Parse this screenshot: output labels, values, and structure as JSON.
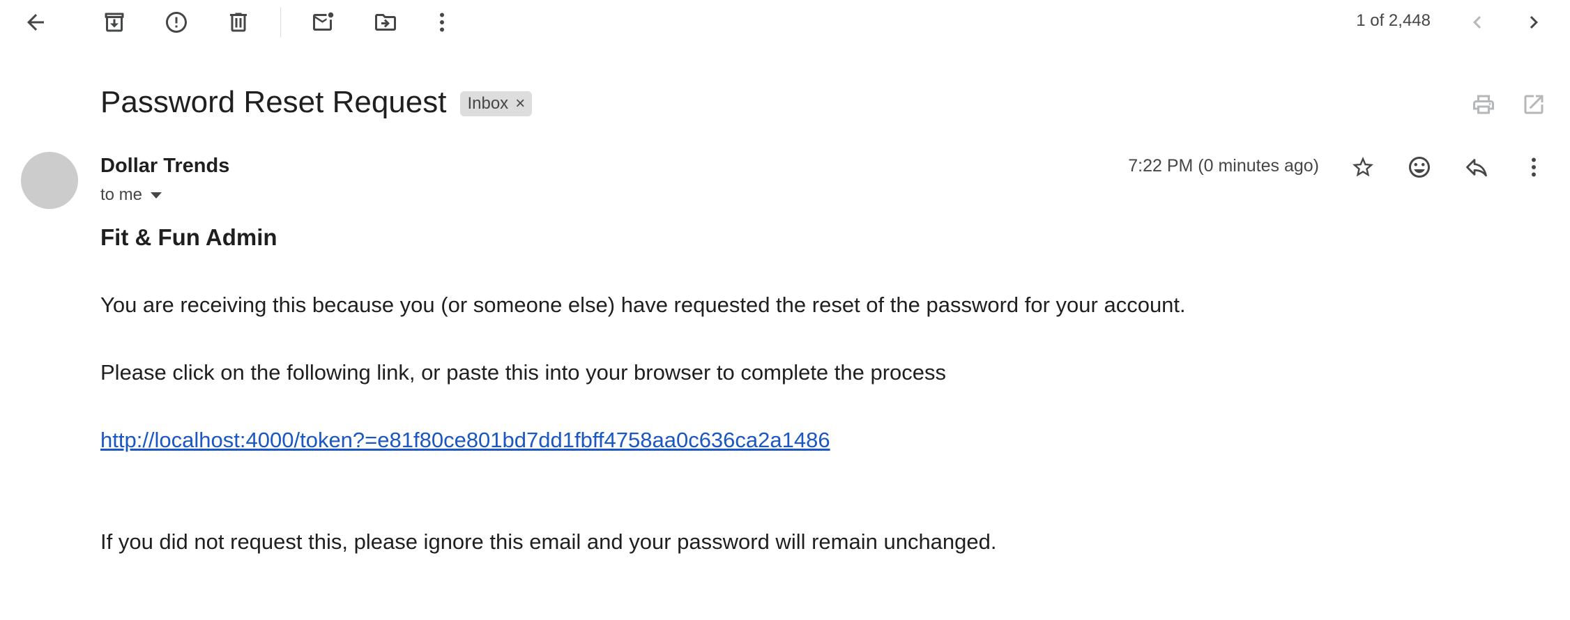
{
  "toolbar": {
    "icons": [
      "back-icon",
      "archive-icon",
      "report-spam-icon",
      "delete-icon",
      "mark-unread-icon",
      "move-to-icon",
      "more-vert-icon"
    ],
    "counter": "1 of 2,448",
    "nav_icons": [
      "chevron-left-icon",
      "chevron-right-icon"
    ]
  },
  "email": {
    "subject": "Password Reset Request",
    "label": "Inbox",
    "label_remove": "×",
    "header_actions": [
      "print-icon",
      "open-new-window-icon"
    ],
    "sender": "Dollar Trends",
    "recipient": "to me",
    "timestamp": "7:22 PM (0 minutes ago)",
    "message_actions": [
      "star-icon",
      "emoji-icon",
      "reply-icon",
      "more-vert-icon"
    ],
    "body": {
      "heading": "Fit & Fun Admin",
      "line1": "You are receiving this because you (or someone else) have requested the reset of the password for your account.",
      "line2": "Please click on the following link, or paste this into your browser to complete the process",
      "link": "http://localhost:4000/token?=e81f80ce801bd7dd1fbff4758aa0c636ca2a1486",
      "line3": "If you did not request this, please ignore this email and your password will remain unchanged."
    }
  },
  "colors": {
    "link": "#1a57c2",
    "avatar": "#cccccc",
    "chip_bg": "#dddddd",
    "icon": "#444746"
  }
}
